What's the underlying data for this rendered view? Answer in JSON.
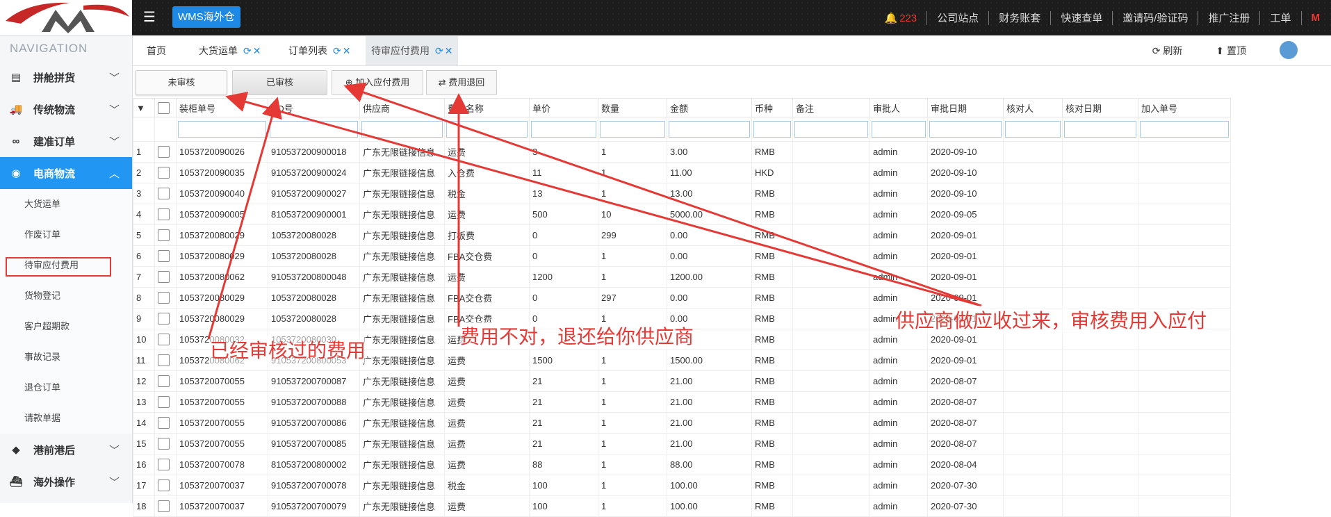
{
  "app": {
    "brand": "WMS海外仓",
    "logo_text": "M"
  },
  "topbar": {
    "notif_count": "223",
    "links": [
      "公司站点",
      "财务账套",
      "快速查单",
      "邀请码/验证码",
      "推广注册",
      "工单"
    ]
  },
  "sidebar": {
    "title": "NAVIGATION",
    "groups_top": [
      {
        "label": "拼舱拼货",
        "icon": "server-icon"
      },
      {
        "label": "传统物流",
        "icon": "truck-icon"
      },
      {
        "label": "建准订单",
        "icon": "link-icon"
      },
      {
        "label": "电商物流",
        "icon": "globe-icon"
      }
    ],
    "sub_items": [
      "大货运单",
      "作废订单",
      "待审应付费用",
      "货物登记",
      "客户超期款",
      "事故记录",
      "退仓订单",
      "请款单据"
    ],
    "groups_bottom": [
      {
        "label": "港前港后",
        "icon": "cubes-icon"
      },
      {
        "label": "海外操作",
        "icon": "ship-icon"
      }
    ]
  },
  "tabs": [
    {
      "label": "首页"
    },
    {
      "label": "大货运单"
    },
    {
      "label": "订单列表"
    },
    {
      "label": "待审应付费用"
    }
  ],
  "tab_tools": {
    "refresh": "刷新",
    "top": "置顶"
  },
  "toolbar": {
    "unreviewed": "未审核",
    "reviewed": "已审核",
    "add_fee": "加入应付费用",
    "return_fee": "费用退回"
  },
  "table": {
    "columns": [
      "装柜单号",
      "SO号",
      "供应商",
      "费用名称",
      "单价",
      "数量",
      "金额",
      "币种",
      "备注",
      "审批人",
      "审批日期",
      "核对人",
      "核对日期",
      "加入单号"
    ],
    "rows": [
      [
        "1",
        "1053720090026",
        "910537200900018",
        "广东无限链接信息",
        "运费",
        "3",
        "1",
        "3.00",
        "RMB",
        "",
        "admin",
        "2020-09-10",
        "",
        "",
        ""
      ],
      [
        "2",
        "1053720090035",
        "910537200900024",
        "广东无限链接信息",
        "入仓费",
        "11",
        "1",
        "11.00",
        "HKD",
        "",
        "admin",
        "2020-09-10",
        "",
        "",
        ""
      ],
      [
        "3",
        "1053720090040",
        "910537200900027",
        "广东无限链接信息",
        "税金",
        "13",
        "1",
        "13.00",
        "RMB",
        "",
        "admin",
        "2020-09-10",
        "",
        "",
        ""
      ],
      [
        "4",
        "1053720090005",
        "810537200900001",
        "广东无限链接信息",
        "运费",
        "500",
        "10",
        "5000.00",
        "RMB",
        "",
        "admin",
        "2020-09-05",
        "",
        "",
        ""
      ],
      [
        "5",
        "1053720080029",
        "1053720080028",
        "广东无限链接信息",
        "打板费",
        "0",
        "299",
        "0.00",
        "RMB",
        "",
        "admin",
        "2020-09-01",
        "",
        "",
        ""
      ],
      [
        "6",
        "1053720080029",
        "1053720080028",
        "广东无限链接信息",
        "FBA交仓费",
        "0",
        "1",
        "0.00",
        "RMB",
        "",
        "admin",
        "2020-09-01",
        "",
        "",
        ""
      ],
      [
        "7",
        "1053720080062",
        "910537200800048",
        "广东无限链接信息",
        "运费",
        "1200",
        "1",
        "1200.00",
        "RMB",
        "",
        "admin",
        "2020-09-01",
        "",
        "",
        ""
      ],
      [
        "8",
        "1053720080029",
        "1053720080028",
        "广东无限链接信息",
        "FBA交仓费",
        "0",
        "297",
        "0.00",
        "RMB",
        "",
        "admin",
        "2020-09-01",
        "",
        "",
        ""
      ],
      [
        "9",
        "1053720080029",
        "1053720080028",
        "广东无限链接信息",
        "FBA交仓费",
        "0",
        "1",
        "0.00",
        "RMB",
        "",
        "admin",
        "2020-09-01",
        "",
        "",
        ""
      ],
      [
        "10",
        "1053720080032",
        "1053720080030",
        "广东无限链接信息",
        "运费",
        "",
        "",
        "",
        "RMB",
        "",
        "admin",
        "2020-09-01",
        "",
        "",
        ""
      ],
      [
        "11",
        "1053720080062",
        "910537200800053",
        "广东无限链接信息",
        "运费",
        "1500",
        "1",
        "1500.00",
        "RMB",
        "",
        "admin",
        "2020-09-01",
        "",
        "",
        ""
      ],
      [
        "12",
        "1053720070055",
        "910537200700087",
        "广东无限链接信息",
        "运费",
        "21",
        "1",
        "21.00",
        "RMB",
        "",
        "admin",
        "2020-08-07",
        "",
        "",
        ""
      ],
      [
        "13",
        "1053720070055",
        "910537200700088",
        "广东无限链接信息",
        "运费",
        "21",
        "1",
        "21.00",
        "RMB",
        "",
        "admin",
        "2020-08-07",
        "",
        "",
        ""
      ],
      [
        "14",
        "1053720070055",
        "910537200700086",
        "广东无限链接信息",
        "运费",
        "21",
        "1",
        "21.00",
        "RMB",
        "",
        "admin",
        "2020-08-07",
        "",
        "",
        ""
      ],
      [
        "15",
        "1053720070055",
        "910537200700085",
        "广东无限链接信息",
        "运费",
        "21",
        "1",
        "21.00",
        "RMB",
        "",
        "admin",
        "2020-08-07",
        "",
        "",
        ""
      ],
      [
        "16",
        "1053720070078",
        "810537200800002",
        "广东无限链接信息",
        "运费",
        "88",
        "1",
        "88.00",
        "RMB",
        "",
        "admin",
        "2020-08-04",
        "",
        "",
        ""
      ],
      [
        "17",
        "1053720070037",
        "910537200700078",
        "广东无限链接信息",
        "税金",
        "100",
        "1",
        "100.00",
        "RMB",
        "",
        "admin",
        "2020-07-30",
        "",
        "",
        ""
      ],
      [
        "18",
        "1053720070037",
        "910537200700079",
        "广东无限链接信息",
        "运费",
        "100",
        "1",
        "100.00",
        "RMB",
        "",
        "admin",
        "2020-07-30",
        "",
        "",
        ""
      ]
    ]
  },
  "annotations": {
    "reviewed_note": "已经审核过的费用",
    "return_note": "费用不对，退还给你供应商",
    "supplier_note": "供应商做应收过来，审核费用入应付"
  },
  "colors": {
    "accent": "#2196f3",
    "annotation": "#e53935",
    "topbar": "#1c1c1c"
  }
}
